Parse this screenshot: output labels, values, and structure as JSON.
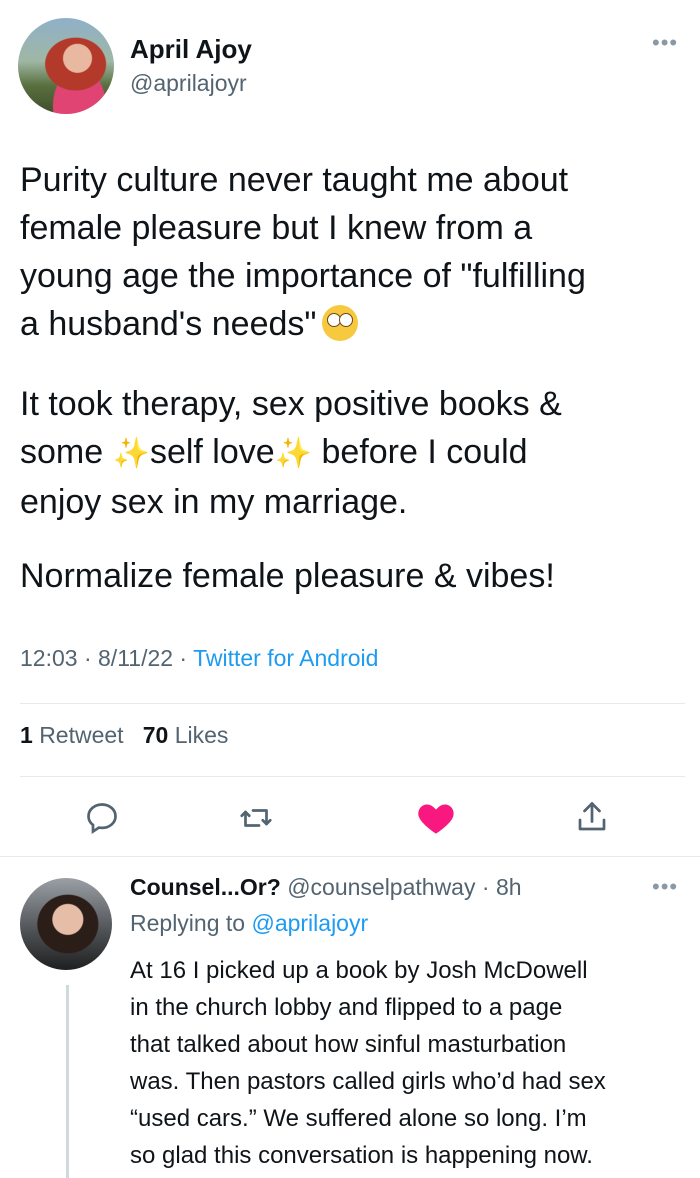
{
  "tweet": {
    "author_name": "April Ajoy",
    "author_handle": "@aprilajoyr",
    "more_icon": "more-icon",
    "paragraph1": {
      "line1": "Purity culture never taught me about",
      "line2": "female pleasure but I knew from a",
      "line3": "young age the importance of \"fulfilling",
      "line4": "a husband's needs\"",
      "emoji": "face-with-rolling-eyes-emoji"
    },
    "paragraph2": {
      "line1": "It took therapy, sex positive books &",
      "line2_a": "some",
      "line2_b": "self love",
      "line2_c": "before I could",
      "line3": "enjoy sex in my marriage.",
      "sparkle": "✨"
    },
    "paragraph3": "Normalize female pleasure & vibes!",
    "time": "12:03",
    "date": "8/11/22",
    "source": "Twitter for Android",
    "retweets_count": "1",
    "retweets_label": "Retweet",
    "likes_count": "70",
    "likes_label": "Likes",
    "actions": [
      "reply-icon",
      "retweet-icon",
      "like-icon",
      "share-icon"
    ],
    "liked_color": "#f91880"
  },
  "reply": {
    "author_name": "Counsel...Or?",
    "author_handle": "@counselpathway",
    "time": "8h",
    "replying_to_label": "Replying to",
    "replying_to_handle": "@aprilajoyr",
    "lines": [
      "At 16 I picked up a book by Josh McDowell",
      "in the church lobby and flipped to a page",
      "that talked about how sinful masturbation",
      "was. Then pastors called girls who’d had sex",
      "“used cars.” We suffered alone so long. I’m",
      "so glad this conversation is happening now."
    ]
  }
}
